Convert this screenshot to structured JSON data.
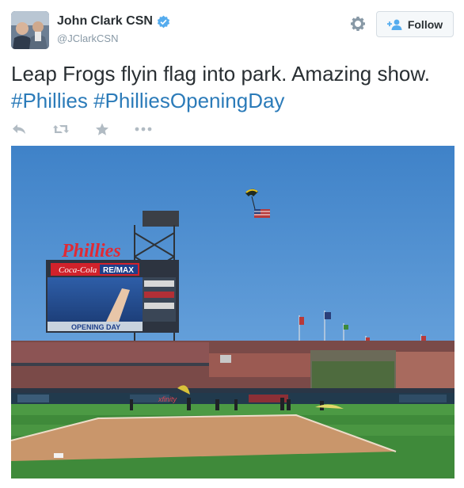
{
  "user": {
    "display_name": "John Clark CSN",
    "handle": "@JClarkCSN",
    "verified": true,
    "avatar_icon": "profile-photo-icon"
  },
  "header": {
    "follow_label": "Follow",
    "settings_icon": "gear-icon"
  },
  "tweet": {
    "text_plain": "Leap Frogs flyin flag into park. Amazing show.",
    "hashtags": [
      "#Phillies",
      "#PhilliesOpeningDay"
    ]
  },
  "actions": [
    "reply-icon",
    "retweet-icon",
    "favorite-icon",
    "more-icon"
  ],
  "photo": {
    "scoreboard_logo": "Phillies",
    "sign_coca_cola": "Coca-Cola",
    "sign_remax": "RE/MAX",
    "sign_opening_day": "OPENING DAY",
    "sign_xfinity": "xfinity"
  },
  "colors": {
    "hashtag": "#2b7bb9",
    "verified": "#55acee",
    "sky": "#4f90cf",
    "grass": "#3f8a3a",
    "dirt": "#c9966b"
  }
}
